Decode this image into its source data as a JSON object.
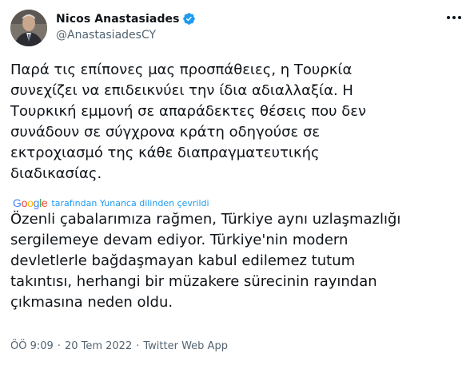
{
  "author": {
    "display_name": "Nicos Anastasiades",
    "handle": "@AnastasiadesCY",
    "verified": true
  },
  "tweet": {
    "text": "Παρά τις επίπονες μας προσπάθειες, η Τουρκία\nσυνεχίζει να επιδεικνύει την ίδια αδιαλλαξία. Η\nΤουρκική εμμονή σε απαράδεκτες θέσεις που δεν\nσυνάδουν σε σύγχρονα κράτη οδηγούσε σε\nεκτροχιασμό της κάθε διαπραγματευτικής\nδιαδικασίας.",
    "translation_label": "tarafından Yunanca dilinden çevrildi",
    "translation_provider": "Google",
    "translated_text": "Özenli çabalarımıza rağmen, Türkiye aynı uzlaşmazlığı\nsergilemeye devam ediyor. Türkiye'nin modern\ndevletlerle bağdaşmayan kabul edilemez tutum\ntakıntısı, herhangi bir müzakere sürecinin rayından\nçıkmasına neden oldu."
  },
  "meta": {
    "time": "ÖÖ 9:09",
    "separator1": "·",
    "date": "20 Tem 2022",
    "separator2": "·",
    "source": "Twitter Web App"
  },
  "icons": {
    "verified": "verified-badge-icon",
    "more": "more-options-icon"
  },
  "colors": {
    "verified": "#1d9bf0",
    "link": "#1d9bf0",
    "secondary_text": "#536471",
    "primary_text": "#0f1419"
  }
}
